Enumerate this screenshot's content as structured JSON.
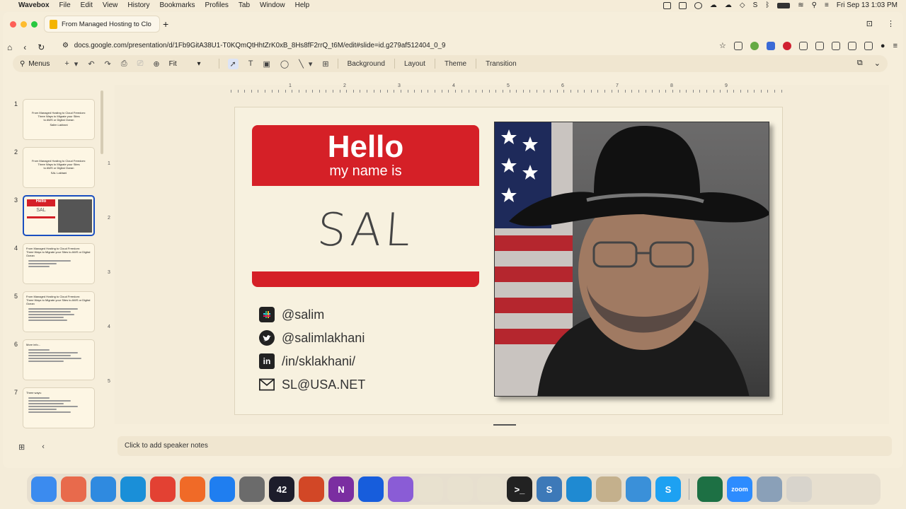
{
  "menubar": {
    "app": "Wavebox",
    "items": [
      "File",
      "Edit",
      "View",
      "History",
      "Bookmarks",
      "Profiles",
      "Tab",
      "Window",
      "Help"
    ],
    "datetime": "Fri Sep 13  1:03 PM"
  },
  "browser": {
    "tab_title": "From Managed Hosting to Clo",
    "url": "docs.google.com/presentation/d/1Fb9GitA38U1-T0KQmQtHhtZrK0xB_8Hs8fF2rrQ_t6M/edit#slide=id.g279af512404_0_9"
  },
  "toolbar": {
    "menus_label": "Menus",
    "zoom_label": "Fit",
    "background_label": "Background",
    "layout_label": "Layout",
    "theme_label": "Theme",
    "transition_label": "Transition"
  },
  "ruler": [
    "1",
    "2",
    "3",
    "4",
    "5",
    "6",
    "7",
    "8",
    "9"
  ],
  "vruler": [
    "1",
    "2",
    "3",
    "4",
    "5"
  ],
  "thumbnails": [
    {
      "num": "1",
      "lines": [
        "From Managed Hosting to Cloud Freedom:",
        "Three Ways to Migrate your Sites",
        "to AWS or Digital Ocean",
        "Salim Lakhani"
      ]
    },
    {
      "num": "2",
      "lines": [
        "From Managed Hosting to Cloud Freedom:",
        "Three Ways to Migrate your Sites",
        "to AWS or Digital Ocean",
        "SAL Lakhani"
      ]
    },
    {
      "num": "3",
      "lines": [
        "Hello",
        "SAL"
      ]
    },
    {
      "num": "4",
      "lines": [
        "From Managed Hosting to Cloud Freedom:",
        "Three Ways to Migrate your Sites to AWS or Digital Ocean"
      ]
    },
    {
      "num": "5",
      "lines": [
        "From Managed Hosting to Cloud Freedom:",
        "Three Ways to Migrate your Sites to AWS or Digital Ocean"
      ]
    },
    {
      "num": "6",
      "lines": [
        "More info..."
      ]
    },
    {
      "num": "7",
      "lines": [
        "Three ways:"
      ]
    }
  ],
  "slide": {
    "hello": "Hello",
    "my_name_is": "my name is",
    "name": "SAL",
    "contacts": [
      {
        "icon": "slack-icon",
        "text": "@salim"
      },
      {
        "icon": "twitter-icon",
        "text": "@salimlakhani"
      },
      {
        "icon": "linkedin-icon",
        "text": "/in/sklakhani/"
      },
      {
        "icon": "mail-icon",
        "text": "SL@USA.NET"
      }
    ],
    "colors": {
      "red": "#d52027"
    }
  },
  "notes": {
    "placeholder": "Click to add speaker notes"
  },
  "dock": {
    "apps": [
      {
        "name": "finder",
        "label": "",
        "color": "#3b8bef"
      },
      {
        "name": "launchpad",
        "label": "",
        "color": "#e86a4c"
      },
      {
        "name": "safari",
        "label": "",
        "color": "#2f8ae0"
      },
      {
        "name": "edge",
        "label": "",
        "color": "#1a8fd8"
      },
      {
        "name": "chrome",
        "label": "",
        "color": "#e34133"
      },
      {
        "name": "firefox",
        "label": "",
        "color": "#f06a27"
      },
      {
        "name": "app-store",
        "label": "",
        "color": "#1f7ef0"
      },
      {
        "name": "system-settings",
        "label": "",
        "color": "#6b6b6b"
      },
      {
        "name": "42",
        "label": "42",
        "color": "#1d1d2b"
      },
      {
        "name": "powerpoint",
        "label": "",
        "color": "#d24726"
      },
      {
        "name": "onenote",
        "label": "N",
        "color": "#7b2ea1"
      },
      {
        "name": "bitwarden",
        "label": "",
        "color": "#175ddc"
      },
      {
        "name": "affinity",
        "label": "",
        "color": "#8a5cd6"
      },
      {
        "name": "slack",
        "label": "",
        "color": "#e8e1cf"
      },
      {
        "name": "notes",
        "label": "",
        "color": "#e8e1cf"
      },
      {
        "name": "emoji",
        "label": "",
        "color": "#e8e1cf"
      },
      {
        "name": "terminal",
        "label": ">_",
        "color": "#222"
      },
      {
        "name": "s-app",
        "label": "S",
        "color": "#3d79b8"
      },
      {
        "name": "vscode",
        "label": "",
        "color": "#1f8ad2"
      },
      {
        "name": "wavebox",
        "label": "",
        "color": "#c4b08c"
      },
      {
        "name": "freeform",
        "label": "",
        "color": "#3a90d9"
      },
      {
        "name": "skype",
        "label": "S",
        "color": "#1da1f2"
      },
      {
        "name": "excel",
        "label": "",
        "color": "#1d7044"
      },
      {
        "name": "zoom",
        "label": "zoom",
        "color": "#2d8cff"
      },
      {
        "name": "preview",
        "label": "",
        "color": "#8aa0b8"
      },
      {
        "name": "trash",
        "label": "",
        "color": "#d8d4cc"
      }
    ]
  }
}
